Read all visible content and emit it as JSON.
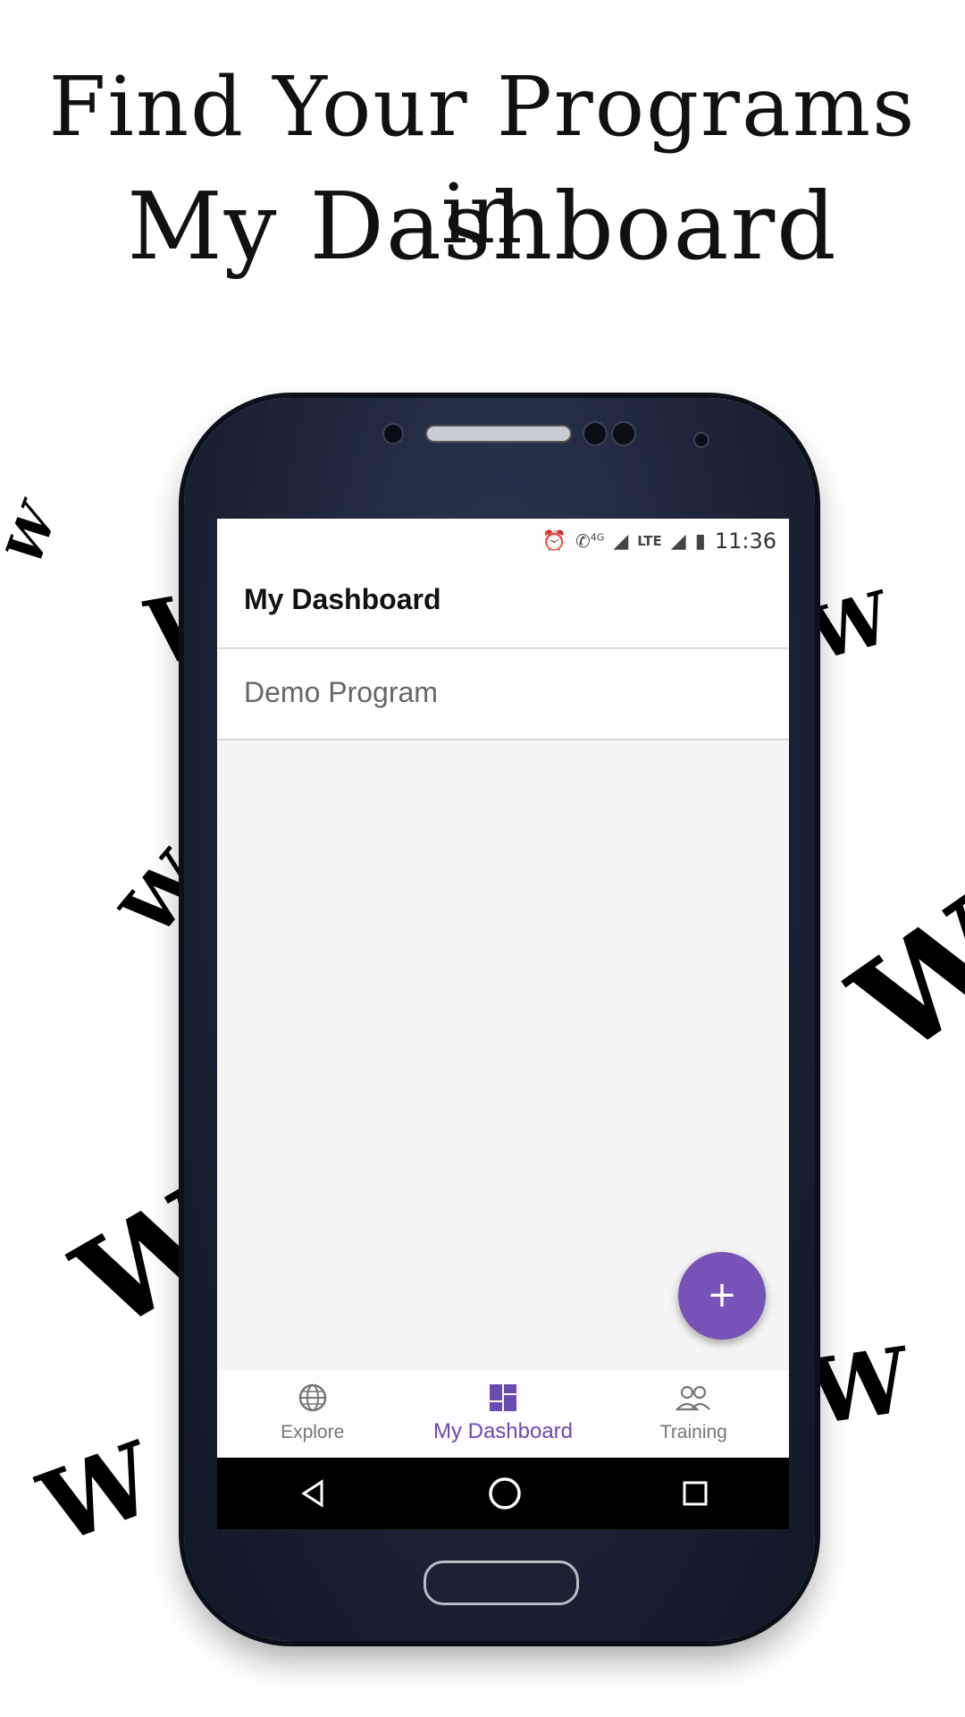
{
  "headline": {
    "line1": "Find Your Programs in",
    "line2": "My Dashboard"
  },
  "decor": {
    "mark": "W"
  },
  "status_bar": {
    "network_4g": "4G",
    "network_lte": "LTE",
    "time": "11:36"
  },
  "app_bar": {
    "title": "My Dashboard"
  },
  "programs": [
    {
      "name": "Demo Program"
    }
  ],
  "fab": {
    "label": "+",
    "accent": "#7753b8"
  },
  "bottom_nav": {
    "items": [
      {
        "label": "Explore",
        "icon": "globe-icon"
      },
      {
        "label": "My Dashboard",
        "icon": "dashboard-icon",
        "active": true
      },
      {
        "label": "Training",
        "icon": "people-icon"
      }
    ],
    "active_color": "#6a4bb0"
  },
  "system_nav": {
    "icons": [
      "back-icon",
      "home-icon",
      "recents-icon"
    ]
  }
}
